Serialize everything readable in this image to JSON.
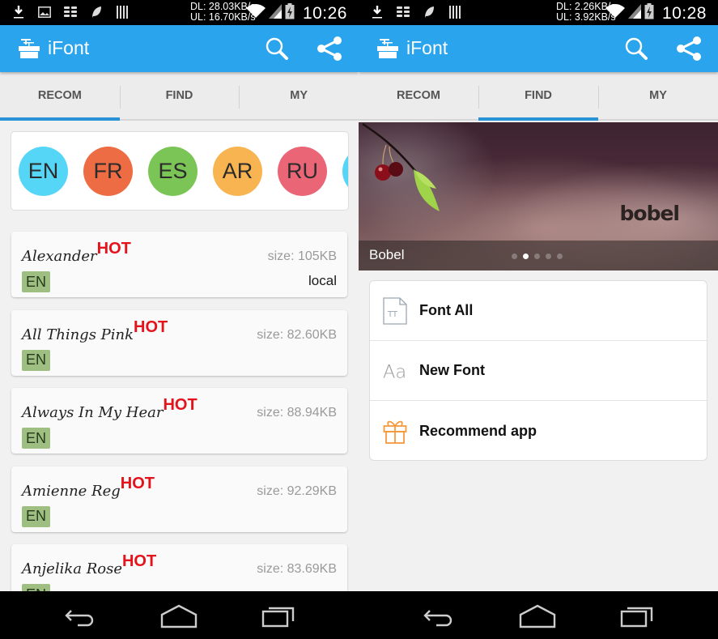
{
  "screens": {
    "left": {
      "status": {
        "dl": "DL: 28.03KB/s",
        "ul": "UL: 16.70KB/s",
        "time": "10:26"
      },
      "app_title": "iFont",
      "tabs": [
        {
          "label": "RECOM",
          "active": true
        },
        {
          "label": "FIND"
        },
        {
          "label": "MY"
        }
      ],
      "languages": [
        {
          "code": "EN",
          "color": "#55d6f7"
        },
        {
          "code": "FR",
          "color": "#ee6c43"
        },
        {
          "code": "ES",
          "color": "#7ac555"
        },
        {
          "code": "AR",
          "color": "#f7b451"
        },
        {
          "code": "RU",
          "color": "#ea6677"
        },
        {
          "code": "",
          "color": "#55d6f7"
        }
      ],
      "fonts": [
        {
          "name": "Alexander",
          "badge": "HOT",
          "size": "size: 105KB",
          "lang": "EN",
          "status": "local"
        },
        {
          "name": "All Things Pink",
          "badge": "HOT",
          "size": "size: 82.60KB",
          "lang": "EN",
          "status": ""
        },
        {
          "name": "Always In My Hear",
          "badge": "HOT",
          "size": "size: 88.94KB",
          "lang": "EN",
          "status": ""
        },
        {
          "name": "Amienne Reg",
          "badge": "HOT",
          "size": "size: 92.29KB",
          "lang": "EN",
          "status": ""
        },
        {
          "name": "Anjelika Rose",
          "badge": "HOT",
          "size": "size: 83.69KB",
          "lang": "EN",
          "status": ""
        }
      ]
    },
    "right": {
      "status": {
        "dl": "DL: 2.26KB/s",
        "ul": "UL: 3.92KB/s",
        "time": "10:28"
      },
      "app_title": "iFont",
      "tabs": [
        {
          "label": "RECOM"
        },
        {
          "label": "FIND",
          "active": true
        },
        {
          "label": "MY"
        }
      ],
      "banner": {
        "title": "Bobel",
        "brand_text": "bobel",
        "slide_count": 5,
        "active_slide": 2
      },
      "menu": [
        {
          "label": "Font All",
          "icon": "font-file-icon"
        },
        {
          "label": "New Font",
          "icon": "aa-icon"
        },
        {
          "label": "Recommend app",
          "icon": "gift-icon"
        }
      ]
    }
  },
  "colors": {
    "actionbar": "#2aa4ec",
    "tab_indicator": "#2a93d8",
    "hot": "#e3121b",
    "lang_badge": "#9fbe82",
    "gift": "#f59a3c"
  }
}
